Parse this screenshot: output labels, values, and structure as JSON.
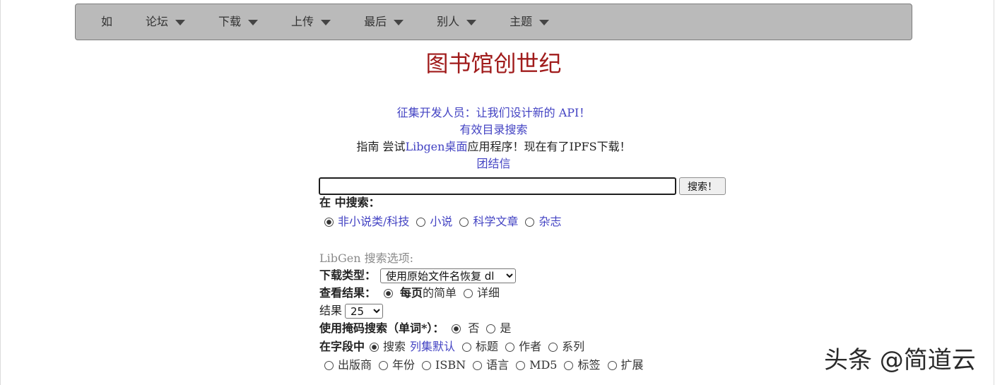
{
  "colors": {
    "text": "#222222",
    "title": "#a01b1b",
    "link": "#4343c3",
    "muted": "#8a8a8a",
    "nav_bg": "#bababa",
    "nav_border": "#7d7d7d",
    "nav_text": "#333333"
  },
  "nav": {
    "items": [
      {
        "label": "如"
      },
      {
        "label": "论坛",
        "icon": "caret-down-icon"
      },
      {
        "label": "下载",
        "icon": "caret-down-icon"
      },
      {
        "label": "上传",
        "icon": "caret-down-icon"
      },
      {
        "label": "最后",
        "icon": "caret-down-icon"
      },
      {
        "label": "别人",
        "icon": "caret-down-icon"
      },
      {
        "label": "主题",
        "icon": "caret-down-icon"
      }
    ]
  },
  "title": "图书馆创世纪",
  "notices": {
    "dev_call": {
      "text": "征集开发人员：让我们设计新的 ",
      "api": "API！"
    },
    "catalog": "有效目录搜索",
    "guide": {
      "pre": "指南 尝试",
      "link": "Libgen桌面",
      "post": "应用程序！现在有了IPFS下载！"
    },
    "solidarity": "团结信"
  },
  "search": {
    "query": "",
    "button": "搜索！",
    "in_label": "在 中搜索：",
    "topics": [
      {
        "label": "非小说类/科技",
        "checked": true
      },
      {
        "label": "小说",
        "checked": false
      },
      {
        "label": "科学文章",
        "checked": false
      },
      {
        "label": "杂志",
        "checked": false
      }
    ]
  },
  "options": {
    "heading": "LibGen 搜索选项:",
    "download_type": {
      "label": "下载类型：",
      "selected": "使用原始文件名恢复 dl"
    },
    "view": {
      "label": "查看结果：",
      "simple": {
        "bold": "每页",
        "rest": "的简单",
        "checked": true
      },
      "detailed": {
        "label": "详细",
        "checked": false
      }
    },
    "results": {
      "label": "结果",
      "selected": "25"
    },
    "mask": {
      "label": "使用掩码搜索（单词*）：",
      "options": [
        {
          "label": "否",
          "checked": true
        },
        {
          "label": "是",
          "checked": false
        }
      ]
    },
    "fields": {
      "label": "在字段中",
      "default": {
        "label": "搜索",
        "link": "列集默认",
        "checked": true
      },
      "options": [
        {
          "label": "标题",
          "checked": false
        },
        {
          "label": "作者",
          "checked": false
        },
        {
          "label": "系列",
          "checked": false
        },
        {
          "label": "出版商",
          "checked": false
        },
        {
          "label": "年份",
          "checked": false
        },
        {
          "label": "ISBN",
          "checked": false
        },
        {
          "label": "语言",
          "checked": false
        },
        {
          "label": "MD5",
          "checked": false
        },
        {
          "label": "标签",
          "checked": false
        },
        {
          "label": "扩展",
          "checked": false
        }
      ]
    }
  },
  "watermark": "头条 @简道云"
}
